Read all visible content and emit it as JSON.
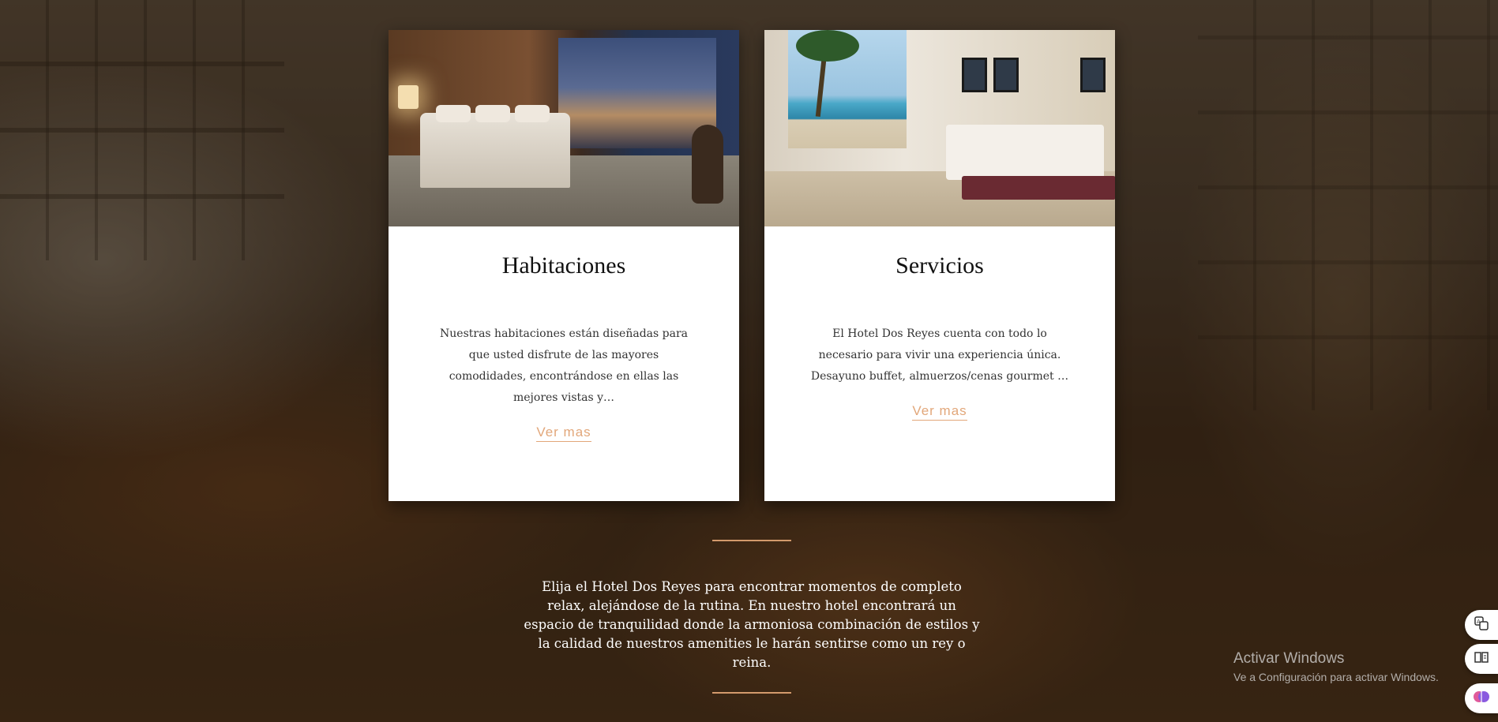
{
  "cards": [
    {
      "title": "Habitaciones",
      "description": "Nuestras habitaciones están diseñadas para que usted disfrute de las mayores comodidades, encontrándose en ellas las mejores vistas y…",
      "link_label": "Ver mas"
    },
    {
      "title": "Servicios",
      "description": "El Hotel Dos Reyes cuenta con todo lo necesario para vivir una experiencia única. Desayuno buffet, almuerzos/cenas gourmet …",
      "link_label": "Ver mas"
    }
  ],
  "intro": {
    "text": "Elija el Hotel Dos Reyes para encontrar momentos de completo relax, alejándose de la rutina. En nuestro hotel encontrará un espacio de tranquilidad donde la armoniosa combinación de estilos y la calidad de nuestros amenities le harán sentirse como un rey o reina."
  },
  "watermark": {
    "title": "Activar Windows",
    "subtitle": "Ve a Configuración para activar Windows."
  },
  "colors": {
    "accent": "#e2a77a",
    "divider": "#d39a6c",
    "card_background": "#ffffff"
  },
  "side_buttons": [
    "translate-icon",
    "reader-icon",
    "brain-icon"
  ]
}
